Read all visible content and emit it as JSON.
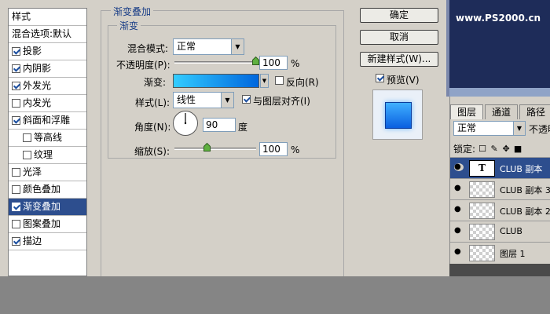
{
  "style_list": {
    "header": "样式",
    "blending": "混合选项:默认",
    "items": [
      {
        "label": "投影",
        "checked": true,
        "indent": false,
        "selected": false
      },
      {
        "label": "内阴影",
        "checked": true,
        "indent": false,
        "selected": false
      },
      {
        "label": "外发光",
        "checked": true,
        "indent": false,
        "selected": false
      },
      {
        "label": "内发光",
        "checked": false,
        "indent": false,
        "selected": false
      },
      {
        "label": "斜面和浮雕",
        "checked": true,
        "indent": false,
        "selected": false
      },
      {
        "label": "等高线",
        "checked": false,
        "indent": true,
        "selected": false
      },
      {
        "label": "纹理",
        "checked": false,
        "indent": true,
        "selected": false
      },
      {
        "label": "光泽",
        "checked": false,
        "indent": false,
        "selected": false
      },
      {
        "label": "颜色叠加",
        "checked": false,
        "indent": false,
        "selected": false
      },
      {
        "label": "渐变叠加",
        "checked": true,
        "indent": false,
        "selected": true
      },
      {
        "label": "图案叠加",
        "checked": false,
        "indent": false,
        "selected": false
      },
      {
        "label": "描边",
        "checked": true,
        "indent": false,
        "selected": false
      }
    ]
  },
  "panel": {
    "title": "渐变叠加",
    "subtitle": "渐变",
    "blend_mode_label": "混合模式:",
    "blend_mode_value": "正常",
    "opacity_label": "不透明度(P):",
    "opacity_value": "100",
    "opacity_fraction": 1.0,
    "opacity_unit": "%",
    "gradient_label": "渐变:",
    "gradient_colors": [
      "#33ccff",
      "#0066dd"
    ],
    "reverse_label": "反向(R)",
    "reverse_checked": false,
    "style_label": "样式(L):",
    "style_value": "线性",
    "align_label": "与图层对齐(I)",
    "align_checked": true,
    "angle_label": "角度(N):",
    "angle_value": "90",
    "angle_unit": "度",
    "scale_label": "缩放(S):",
    "scale_value": "100",
    "scale_fraction": 0.4,
    "scale_unit": "%"
  },
  "buttons": {
    "ok": "确定",
    "cancel": "取消",
    "new_style": "新建样式(W)...",
    "preview_label": "预览(V)",
    "preview_checked": true
  },
  "banner": {
    "text": "www.PS2000.cn"
  },
  "layers": {
    "tabs": [
      "图层",
      "通道",
      "路径"
    ],
    "blend_mode": "正常",
    "opacity_label": "不透明",
    "lock_label": "锁定:",
    "rows": [
      {
        "name": "CLUB 副本",
        "type": "text",
        "thumb_text": "T",
        "selected": true
      },
      {
        "name": "CLUB 副本 3",
        "type": "raster",
        "thumb_text": "",
        "selected": false
      },
      {
        "name": "CLUB 副本 2",
        "type": "raster",
        "thumb_text": "",
        "selected": false
      },
      {
        "name": "CLUB",
        "type": "raster",
        "thumb_text": "",
        "selected": false
      },
      {
        "name": "图层 1",
        "type": "raster",
        "thumb_text": "",
        "selected": false
      }
    ]
  },
  "colors": {
    "accent": "#2d4e8e",
    "banner_bg": "#1e2c59"
  }
}
